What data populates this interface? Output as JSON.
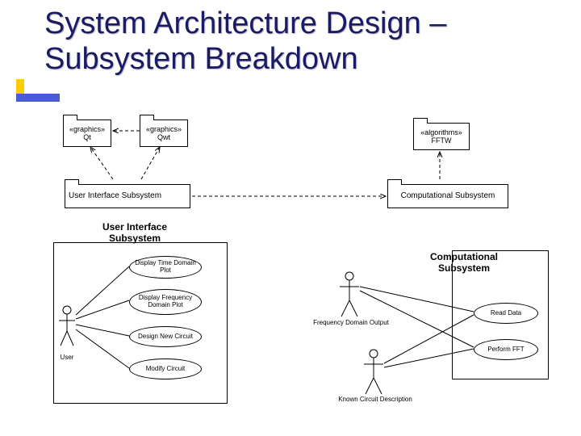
{
  "slide": {
    "title": "System Architecture Design – Subsystem Breakdown"
  },
  "packages": {
    "qt": {
      "stereo": "«graphics»",
      "name": "Qt"
    },
    "qwt": {
      "stereo": "«graphics»",
      "name": "Qwt"
    },
    "fftw": {
      "stereo": "«algorithms»",
      "name": "FFTW"
    },
    "ui": {
      "name": "User Interface Subsystem"
    },
    "comp": {
      "name": "Computational Subsystem"
    }
  },
  "sections": {
    "ui": {
      "label": "User Interface Subsystem"
    },
    "comp": {
      "label": "Computational Subsystem"
    }
  },
  "usecases": {
    "ui": {
      "actor": "User",
      "items": [
        "Display Time Domain Plot",
        "Display Frequency Domain Plot",
        "Design New Circuit",
        "Modify Circuit"
      ]
    },
    "comp": {
      "inputs": [
        "Frequency Domain Output",
        "Known Circuit Description"
      ],
      "items": [
        "Read Data",
        "Perform FFT"
      ]
    }
  }
}
